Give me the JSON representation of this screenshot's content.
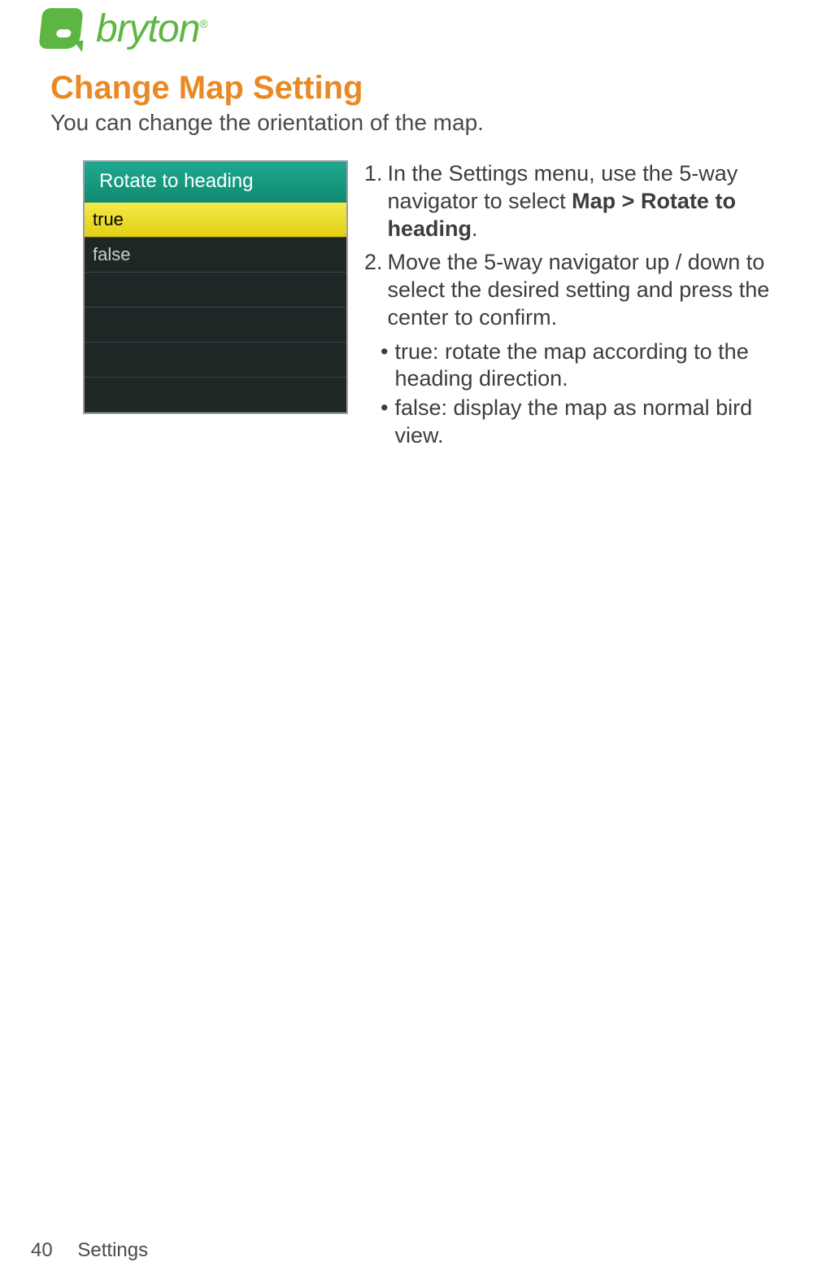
{
  "header": {
    "brand": "bryton",
    "trademark": "®"
  },
  "page": {
    "title": "Change Map Setting",
    "subtitle": "You can change the orientation of the map."
  },
  "device": {
    "title": "Rotate to heading",
    "rows": [
      "true",
      "false"
    ],
    "selectedIndex": 0,
    "emptyRows": 4
  },
  "steps": {
    "s1_num": "1.",
    "s1_a": "In the Settings menu, use the 5-way navigator to select ",
    "s1_b": "Map > Rotate to heading",
    "s1_c": ".",
    "s2_num": "2.",
    "s2": "Move the 5-way navigator up / down to select the desired setting and press the center to confirm.",
    "b1_dot": "•",
    "b1": "true: rotate the map according to the heading direction.",
    "b2_dot": "•",
    "b2": "false: display the map as normal bird view."
  },
  "footer": {
    "pageNumber": "40",
    "section": "Settings"
  }
}
